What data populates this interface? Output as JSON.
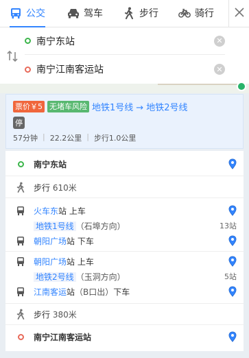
{
  "tabs": [
    {
      "id": "bus",
      "label": "公交",
      "icon": "bus-icon",
      "active": true
    },
    {
      "id": "car",
      "label": "驾车",
      "icon": "car-icon",
      "active": false
    },
    {
      "id": "walk",
      "label": "步行",
      "icon": "walk-icon",
      "active": false
    },
    {
      "id": "bike",
      "label": "骑行",
      "icon": "bike-icon",
      "active": false
    }
  ],
  "route": {
    "start": "南宁东站",
    "end": "南宁江南客运站"
  },
  "summary": {
    "price_badge": "票价￥5",
    "jam_badge": "无堵车风险",
    "line1": "地铁1号线",
    "arrow": "→",
    "line2": "地铁2号线",
    "stop_tag": "停",
    "duration": "57分钟",
    "distance": "22.2公里",
    "walk": "步行1.0公里",
    "separator": "|"
  },
  "steps": {
    "origin": "南宁东站",
    "walk1_label": "步行",
    "walk1_dist": "610米",
    "board1_station": "火车东",
    "board1_suffix": "站",
    "board1_action": "上车",
    "line1_name": "地铁1号线",
    "line1_dir": "（石埠方向）",
    "line1_stops": "13站",
    "alight1_station": "朝阳广场",
    "alight1_suffix": "站",
    "alight1_action": "下车",
    "board2_station": "朝阳广场",
    "board2_suffix": "站",
    "board2_action": "上车",
    "line2_name": "地铁2号线",
    "line2_dir": "（玉洞方向）",
    "line2_stops": "5站",
    "alight2_station": "江南客运",
    "alight2_suffix": "站",
    "alight2_exit": "（B口出）",
    "alight2_action": "下车",
    "walk2_label": "步行",
    "walk2_dist": "380米",
    "destination": "南宁江南客运站"
  },
  "colors": {
    "accent": "#3385ff",
    "start": "#3bb54a",
    "end": "#e86a5a",
    "price": "#f0663c",
    "jam": "#58b870"
  }
}
